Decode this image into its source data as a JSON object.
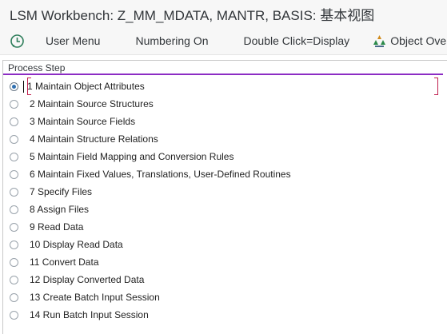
{
  "window": {
    "title": "LSM Workbench: Z_MM_MDATA, MANTR, BASIS: 基本视图"
  },
  "toolbar": {
    "user_menu": "User Menu",
    "numbering": "Numbering On",
    "double_click": "Double Click=Display",
    "object_overview": "Object Overv"
  },
  "process_step": {
    "title": "Process Step",
    "selected_index": 0,
    "steps": [
      {
        "label": "1 Maintain Object Attributes"
      },
      {
        "label": "2 Maintain Source Structures"
      },
      {
        "label": "3 Maintain Source Fields"
      },
      {
        "label": "4 Maintain Structure Relations"
      },
      {
        "label": "5 Maintain Field Mapping and Conversion Rules"
      },
      {
        "label": "6 Maintain Fixed Values, Translations, User-Defined Routines"
      },
      {
        "label": "7 Specify Files"
      },
      {
        "label": "8 Assign Files"
      },
      {
        "label": "9 Read Data"
      },
      {
        "label": "10 Display Read Data"
      },
      {
        "label": "11 Convert Data"
      },
      {
        "label": "12 Display Converted Data"
      },
      {
        "label": "13 Create Batch Input Session"
      },
      {
        "label": "14 Run Batch Input Session"
      }
    ]
  },
  "colors": {
    "accent_line": "#8c2cc4",
    "selection_bracket": "#c0204f",
    "radio_dot": "#2f6fb0"
  },
  "icons": {
    "execute": "execute-clock-icon",
    "object_overview": "object-overview-icon"
  }
}
